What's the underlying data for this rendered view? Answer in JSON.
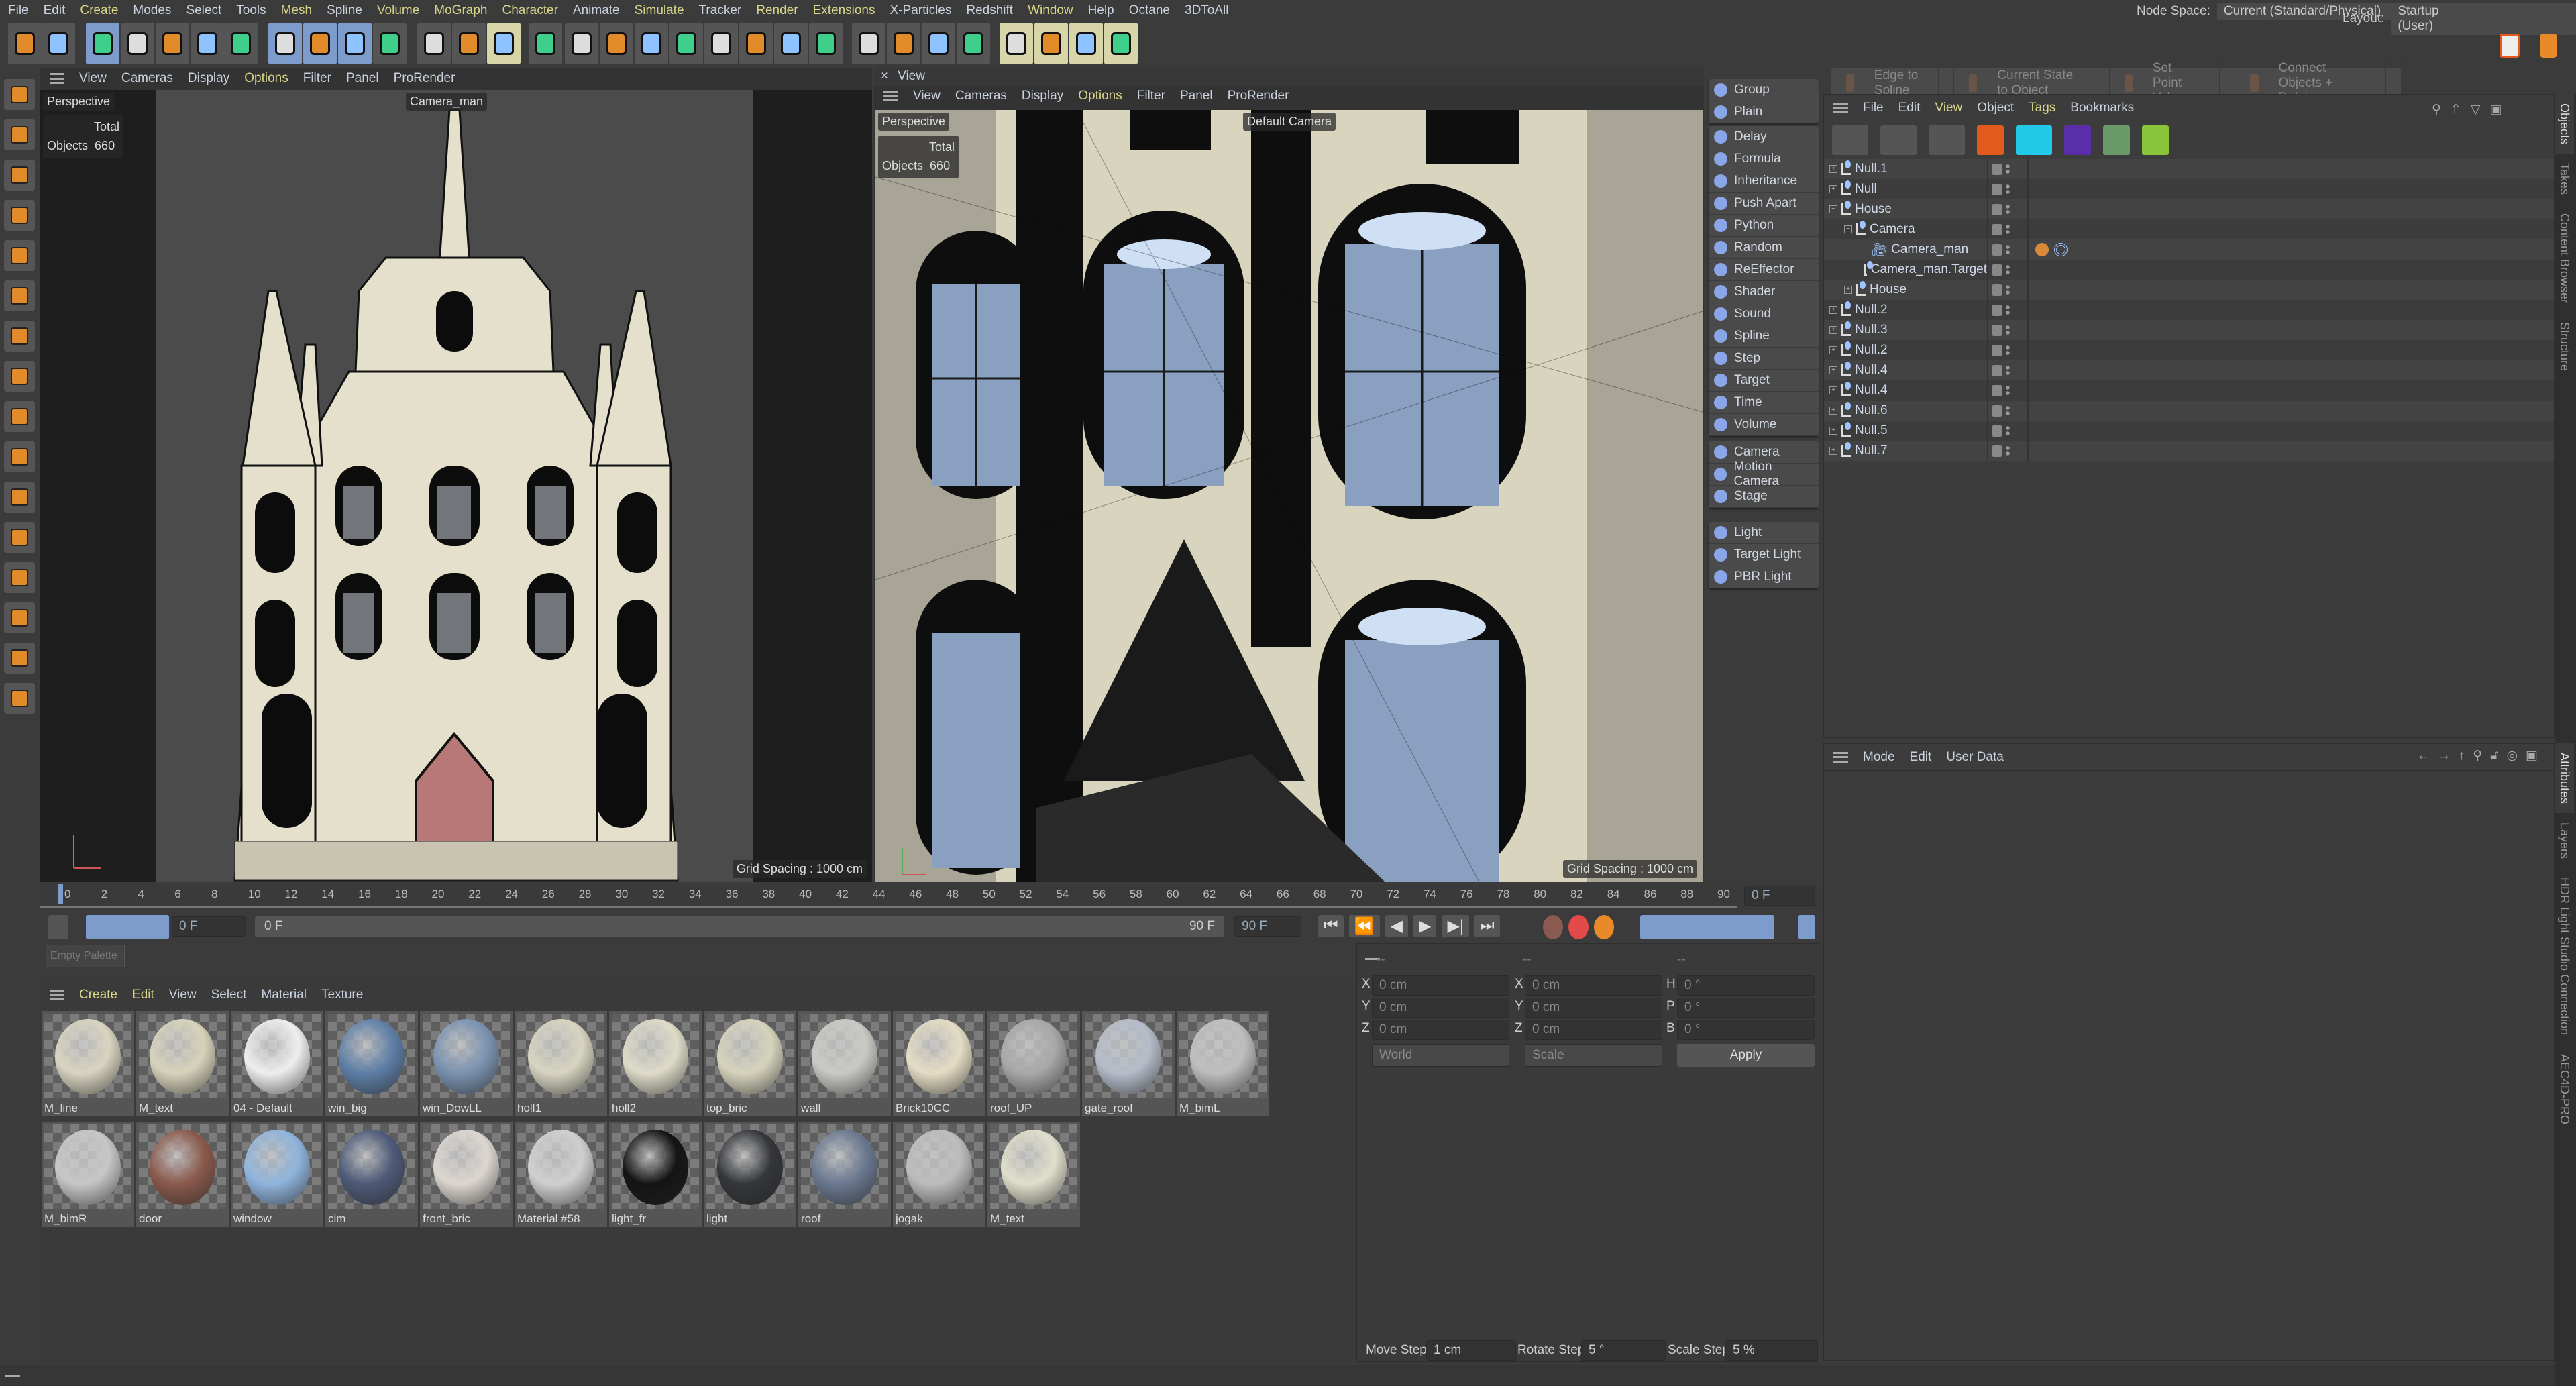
{
  "menu": [
    {
      "label": "File",
      "hl": false
    },
    {
      "label": "Edit",
      "hl": false
    },
    {
      "label": "Create",
      "hl": true
    },
    {
      "label": "Modes",
      "hl": false
    },
    {
      "label": "Select",
      "hl": false
    },
    {
      "label": "Tools",
      "hl": false
    },
    {
      "label": "Mesh",
      "hl": true
    },
    {
      "label": "Spline",
      "hl": false
    },
    {
      "label": "Volume",
      "hl": true
    },
    {
      "label": "MoGraph",
      "hl": true
    },
    {
      "label": "Character",
      "hl": true
    },
    {
      "label": "Animate",
      "hl": false
    },
    {
      "label": "Simulate",
      "hl": true
    },
    {
      "label": "Tracker",
      "hl": false
    },
    {
      "label": "Render",
      "hl": true
    },
    {
      "label": "Extensions",
      "hl": true
    },
    {
      "label": "X-Particles",
      "hl": false
    },
    {
      "label": "Redshift",
      "hl": false
    },
    {
      "label": "Window",
      "hl": true
    },
    {
      "label": "Help",
      "hl": false
    },
    {
      "label": "Octane",
      "hl": false
    },
    {
      "label": "3DToAll",
      "hl": false
    }
  ],
  "header_right": {
    "node_space_label": "Node Space:",
    "node_space_value": "Current (Standard/Physical)",
    "layout_label": "Layout:",
    "layout_value": "Startup (User)"
  },
  "toolbar_icons": [
    {
      "name": "undo-icon",
      "color": "#555"
    },
    {
      "name": "redo-icon",
      "color": "#555"
    },
    {
      "name": "live-selection-icon",
      "color": "#7d9ccc"
    },
    {
      "name": "move-icon",
      "color": "#555"
    },
    {
      "name": "scale-icon",
      "color": "#555"
    },
    {
      "name": "rotate-icon",
      "color": "#555"
    },
    {
      "name": "last-tool-icon",
      "color": "#555"
    },
    {
      "name": "x-axis-icon",
      "color": "#7d9ccc"
    },
    {
      "name": "y-axis-icon",
      "color": "#7d9ccc"
    },
    {
      "name": "z-axis-icon",
      "color": "#7d9ccc"
    },
    {
      "name": "coordinate-system-icon",
      "color": "#555"
    },
    {
      "name": "render-view-icon",
      "color": "#555"
    },
    {
      "name": "render-picture-viewer-icon",
      "color": "#555"
    },
    {
      "name": "render-settings-icon",
      "color": "#d8d6a8"
    },
    {
      "name": "null-icon",
      "color": "#555"
    },
    {
      "name": "cube-icon",
      "color": "#555"
    },
    {
      "name": "pen-icon",
      "color": "#555"
    },
    {
      "name": "subdivision-icon",
      "color": "#555"
    },
    {
      "name": "cloner-icon",
      "color": "#555"
    },
    {
      "name": "deformer-icon",
      "color": "#555"
    },
    {
      "name": "floor-icon",
      "color": "#555"
    },
    {
      "name": "camera-icon",
      "color": "#555"
    },
    {
      "name": "light-icon",
      "color": "#555"
    },
    {
      "name": "tag-icon",
      "color": "#555"
    },
    {
      "name": "character-icon",
      "color": "#555"
    },
    {
      "name": "capsule-icon",
      "color": "#555"
    },
    {
      "name": "spline-mask-icon",
      "color": "#555"
    },
    {
      "name": "bowling-pin-icon",
      "color": "#d8d6a8"
    },
    {
      "name": "sweep-icon",
      "color": "#d8d6a8"
    },
    {
      "name": "hair-icon",
      "color": "#d8d6a8"
    },
    {
      "name": "paint-icon",
      "color": "#d8d6a8"
    }
  ],
  "left_tools": [
    "make-editable-icon",
    "model-mode-icon",
    "points-mode-icon",
    "edges-mode-icon",
    "polygons-mode-icon",
    "uv-mode-icon",
    "texture-mode-icon",
    "axis-mode-icon",
    "workplane-icon",
    "snap-icon",
    "solo-icon",
    "magnet-icon",
    "grid-icon",
    "polygon-pen-icon",
    "knife-icon",
    "brush-icon"
  ],
  "viewport_left": {
    "menu": [
      {
        "label": "View",
        "hl": false
      },
      {
        "label": "Cameras",
        "hl": false
      },
      {
        "label": "Display",
        "hl": false
      },
      {
        "label": "Options",
        "hl": true
      },
      {
        "label": "Filter",
        "hl": false
      },
      {
        "label": "Panel",
        "hl": false
      },
      {
        "label": "ProRender",
        "hl": false
      }
    ],
    "mode": "Perspective",
    "camera": "Camera_man",
    "stats_header": "Total",
    "stats_label": "Objects",
    "stats_value": "660",
    "grid": "Grid Spacing : 1000 cm"
  },
  "viewport_right": {
    "tab": "View",
    "menu": [
      {
        "label": "View",
        "hl": false
      },
      {
        "label": "Cameras",
        "hl": false
      },
      {
        "label": "Display",
        "hl": false
      },
      {
        "label": "Options",
        "hl": true
      },
      {
        "label": "Filter",
        "hl": false
      },
      {
        "label": "Panel",
        "hl": false
      },
      {
        "label": "ProRender",
        "hl": false
      }
    ],
    "mode": "Perspective",
    "camera": "Default Camera",
    "stats_header": "Total",
    "stats_label": "Objects",
    "stats_value": "660",
    "grid": "Grid Spacing : 1000 cm"
  },
  "effector_groups": [
    [
      "Group",
      "Plain"
    ],
    [
      "Delay",
      "Formula",
      "Inheritance",
      "Push Apart",
      "Python",
      "Random",
      "ReEffector",
      "Shader",
      "Sound",
      "Spline",
      "Step",
      "Target",
      "Time",
      "Volume"
    ],
    [
      "Camera",
      "Motion Camera",
      "Stage"
    ],
    [
      "Light",
      "Target Light",
      "PBR Light"
    ]
  ],
  "commands": [
    "Edge to Spline",
    "Current State to Object",
    "Set Point Value",
    "Connect Objects + Delete"
  ],
  "object_manager": {
    "menu": [
      {
        "label": "File",
        "hl": false
      },
      {
        "label": "Edit",
        "hl": false
      },
      {
        "label": "View",
        "hl": true
      },
      {
        "label": "Object",
        "hl": false
      },
      {
        "label": "Tags",
        "hl": true
      },
      {
        "label": "Bookmarks",
        "hl": false
      }
    ],
    "objects": [
      {
        "name": "Null.1",
        "depth": 0,
        "exp": "+",
        "type": "null"
      },
      {
        "name": "Null",
        "depth": 0,
        "exp": "+",
        "type": "null"
      },
      {
        "name": "House",
        "depth": 0,
        "exp": "-",
        "type": "null"
      },
      {
        "name": "Camera",
        "depth": 1,
        "exp": "-",
        "type": "null"
      },
      {
        "name": "Camera_man",
        "depth": 2,
        "exp": "",
        "type": "camera",
        "tags": true
      },
      {
        "name": "Camera_man.Target",
        "depth": 2,
        "exp": "",
        "type": "null"
      },
      {
        "name": "House",
        "depth": 1,
        "exp": "+",
        "type": "null"
      },
      {
        "name": "Null.2",
        "depth": 0,
        "exp": "+",
        "type": "null"
      },
      {
        "name": "Null.3",
        "depth": 0,
        "exp": "+",
        "type": "null"
      },
      {
        "name": "Null.2",
        "depth": 0,
        "exp": "+",
        "type": "null"
      },
      {
        "name": "Null.4",
        "depth": 0,
        "exp": "+",
        "type": "null"
      },
      {
        "name": "Null.4",
        "depth": 0,
        "exp": "+",
        "type": "null"
      },
      {
        "name": "Null.6",
        "depth": 0,
        "exp": "+",
        "type": "null"
      },
      {
        "name": "Null.5",
        "depth": 0,
        "exp": "+",
        "type": "null"
      },
      {
        "name": "Null.7",
        "depth": 0,
        "exp": "+",
        "type": "null"
      }
    ]
  },
  "tabs_top": [
    {
      "label": "Objects",
      "active": true
    },
    {
      "label": "Takes",
      "active": false
    },
    {
      "label": "Content Browser",
      "active": false
    },
    {
      "label": "Structure",
      "active": false
    }
  ],
  "tabs_bottom": [
    {
      "label": "Attributes",
      "active": true
    },
    {
      "label": "Layers",
      "active": false
    },
    {
      "label": "HDR Light Studio Connection",
      "active": false
    },
    {
      "label": "AEC4D-PRO",
      "active": false
    }
  ],
  "attributes": {
    "menu": [
      {
        "label": "Mode"
      },
      {
        "label": "Edit"
      },
      {
        "label": "User Data"
      }
    ]
  },
  "timeline": {
    "ruler_start": 0,
    "ruler_end": 90,
    "ruler_step": 2,
    "current_frame": "0 F",
    "min_field": "0 F",
    "range_start": "0 F",
    "range_end": "90 F",
    "max_field": "90 F"
  },
  "empty_palette": "Empty Palette",
  "materials": {
    "menu": [
      {
        "label": "Create",
        "hl": true
      },
      {
        "label": "Edit",
        "hl": true
      },
      {
        "label": "View",
        "hl": false
      },
      {
        "label": "Select",
        "hl": false
      },
      {
        "label": "Material",
        "hl": false
      },
      {
        "label": "Texture",
        "hl": false
      }
    ],
    "items": [
      {
        "name": "M_line",
        "color": "#d8d4c0"
      },
      {
        "name": "M_text",
        "color": "#d6d2ba"
      },
      {
        "name": "04 - Default",
        "color": "#eeeeee"
      },
      {
        "name": "win_big",
        "color": "#5e7ea6"
      },
      {
        "name": "win_DowLL",
        "color": "#7a92b0"
      },
      {
        "name": "holl1",
        "color": "#d7d4c0"
      },
      {
        "name": "holl2",
        "color": "#dedbc8"
      },
      {
        "name": "top_bric",
        "color": "#d6d3bc"
      },
      {
        "name": "wall",
        "color": "#c9c9c4"
      },
      {
        "name": "Brick10CC",
        "color": "#e4dcc4"
      },
      {
        "name": "roof_UP",
        "color": "#a8a8aa"
      },
      {
        "name": "gate_roof",
        "color": "#b4bcc8"
      },
      {
        "name": "M_bimL",
        "color": "#bdbdbd"
      },
      {
        "name": "M_bimR",
        "color": "#c6c6c6"
      },
      {
        "name": "door",
        "color": "#8a5a4c"
      },
      {
        "name": "window",
        "color": "#8fb4dc"
      },
      {
        "name": "cim",
        "color": "#4e5a78"
      },
      {
        "name": "front_bric",
        "color": "#dcd6d0"
      },
      {
        "name": "Material #58",
        "color": "#cfcfcf"
      },
      {
        "name": "light_fr",
        "color": "#141414"
      },
      {
        "name": "light",
        "color": "#34363a"
      },
      {
        "name": "roof",
        "color": "#6a7890"
      },
      {
        "name": "jogak",
        "color": "#bcbcbc"
      },
      {
        "name": "M_text",
        "color": "#e0decb"
      }
    ]
  },
  "coordinates": {
    "headers": [
      "--",
      "--",
      "--"
    ],
    "rows": [
      [
        {
          "label": "X",
          "value": "0 cm"
        },
        {
          "label": "X",
          "value": "0 cm"
        },
        {
          "label": "H",
          "value": "0 °"
        }
      ],
      [
        {
          "label": "Y",
          "value": "0 cm"
        },
        {
          "label": "Y",
          "value": "0 cm"
        },
        {
          "label": "P",
          "value": "0 °"
        }
      ],
      [
        {
          "label": "Z",
          "value": "0 cm"
        },
        {
          "label": "Z",
          "value": "0 cm"
        },
        {
          "label": "B",
          "value": "0 °"
        }
      ]
    ],
    "space": "World",
    "mode": "Scale",
    "apply": "Apply"
  },
  "steps": {
    "move_label": "Move Step",
    "move_value": "1 cm",
    "rotate_label": "Rotate Step",
    "rotate_value": "5 °",
    "scale_label": "Scale Step",
    "scale_value": "5 %"
  }
}
